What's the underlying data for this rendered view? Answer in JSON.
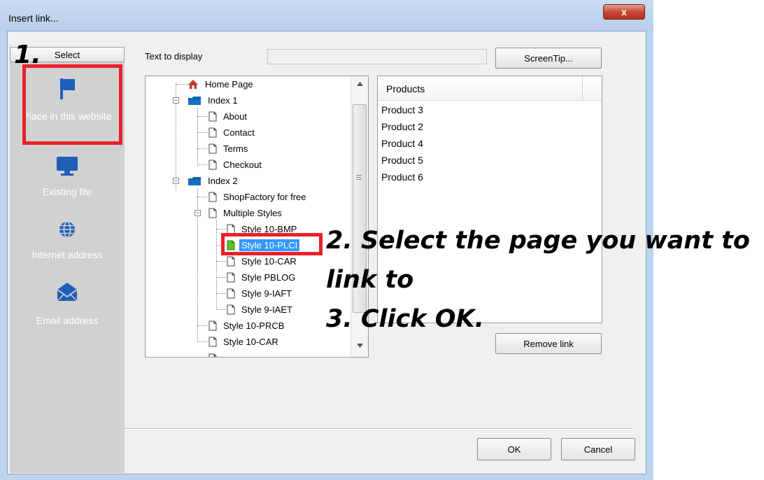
{
  "window": {
    "title": "Insert link...",
    "close_glyph": "x"
  },
  "left_nav": {
    "select_label": "Select",
    "items": [
      {
        "label": "Place in this website",
        "icon": "flag-icon"
      },
      {
        "label": "Existing file",
        "icon": "monitor-icon"
      },
      {
        "label": "Internet address",
        "icon": "globe-icon"
      },
      {
        "label": "Email address",
        "icon": "envelope-icon"
      }
    ]
  },
  "text_to_display": {
    "label": "Text to display",
    "value": ""
  },
  "screentip_label": "ScreenTip...",
  "tree": {
    "items": [
      {
        "label": "Home Page",
        "icon": "home-icon"
      },
      {
        "label": "Index 1",
        "icon": "folder-icon"
      },
      {
        "label": "About",
        "icon": "page-icon"
      },
      {
        "label": "Contact",
        "icon": "page-icon"
      },
      {
        "label": "Terms",
        "icon": "page-icon"
      },
      {
        "label": "Checkout",
        "icon": "page-icon"
      },
      {
        "label": "Index 2",
        "icon": "folder-icon"
      },
      {
        "label": "ShopFactory for free",
        "icon": "page-icon"
      },
      {
        "label": "Multiple Styles",
        "icon": "page-icon"
      },
      {
        "label": "Style 10-BMP",
        "icon": "page-icon"
      },
      {
        "label": "Style 10-PLCI",
        "icon": "page-icon-green"
      },
      {
        "label": "Style 10-CAR",
        "icon": "page-icon"
      },
      {
        "label": "Style PBLOG",
        "icon": "page-icon"
      },
      {
        "label": "Style 9-IAFT",
        "icon": "page-icon"
      },
      {
        "label": "Style 9-IAET",
        "icon": "page-icon"
      },
      {
        "label": "Style 10-PRCB",
        "icon": "page-icon"
      },
      {
        "label": "Style 10-CAR",
        "icon": "page-icon"
      }
    ]
  },
  "products": {
    "header": "Products",
    "items": [
      "Product 3",
      "Product 2",
      "Product 4",
      "Product 5",
      "Product 6"
    ]
  },
  "remove_link_label": "Remove link",
  "ok_label": "OK",
  "cancel_label": "Cancel",
  "annotations": {
    "step1": "1.",
    "step2_line1": "2. Select the page you want to",
    "step2_line2": "link to",
    "step3": "3. Click OK."
  },
  "colors": {
    "highlight_red": "#e8202a",
    "selection_blue": "#3399ff",
    "nav_panel": "#d1d1d1"
  }
}
